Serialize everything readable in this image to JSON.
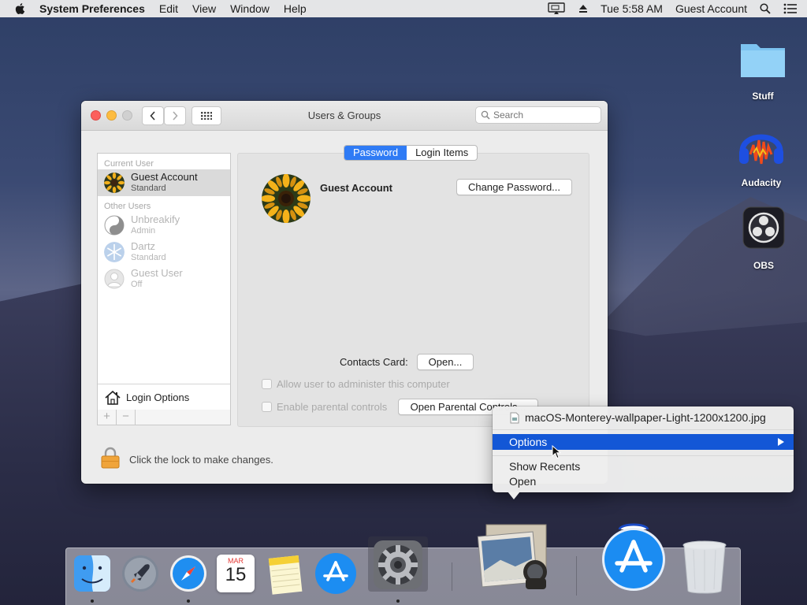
{
  "menubar": {
    "app_name": "System Preferences",
    "menus": [
      "Edit",
      "View",
      "Window",
      "Help"
    ],
    "clock": "Tue 5:58 AM",
    "user": "Guest Account"
  },
  "desktop": {
    "icons": [
      {
        "label": "Stuff"
      },
      {
        "label": "Audacity"
      },
      {
        "label": "OBS"
      }
    ]
  },
  "window": {
    "title": "Users & Groups",
    "search_placeholder": "Search",
    "sidebar": {
      "current_user_header": "Current User",
      "current_user": {
        "name": "Guest Account",
        "role": "Standard"
      },
      "other_users_header": "Other Users",
      "other_users": [
        {
          "name": "Unbreakify",
          "role": "Admin"
        },
        {
          "name": "Dartz",
          "role": "Standard"
        },
        {
          "name": "Guest User",
          "role": "Off"
        }
      ],
      "login_options": "Login Options",
      "add": "+",
      "remove": "−"
    },
    "tabs": [
      {
        "label": "Password",
        "active": true
      },
      {
        "label": "Login Items",
        "active": false
      }
    ],
    "user_display_name": "Guest Account",
    "change_password_label": "Change Password...",
    "contacts_card_label": "Contacts Card:",
    "open_label": "Open...",
    "allow_admin_label": "Allow user to administer this computer",
    "parental_label": "Enable parental controls",
    "open_parental_label": "Open Parental Controls...",
    "lock_text": "Click the lock to make changes."
  },
  "context_menu": {
    "file_item": "macOS-Monterey-wallpaper-Light-1200x1200.jpg",
    "options": "Options",
    "show_recents": "Show Recents",
    "open": "Open"
  },
  "dock": {
    "calendar_month": "MAR",
    "calendar_day": "15",
    "apps": [
      "finder-icon",
      "launchpad-icon",
      "safari-icon",
      "calendar-icon",
      "notes-icon",
      "app-store-icon",
      "system-preferences-icon",
      "preview-icon",
      "app-store-large-icon",
      "trash-icon"
    ]
  },
  "colors": {
    "accent": "#2f7bf5",
    "menu_highlight": "#1357d6",
    "close": "#fc605c",
    "minimize": "#fdbc40",
    "zoom": "#cfcfcf"
  }
}
